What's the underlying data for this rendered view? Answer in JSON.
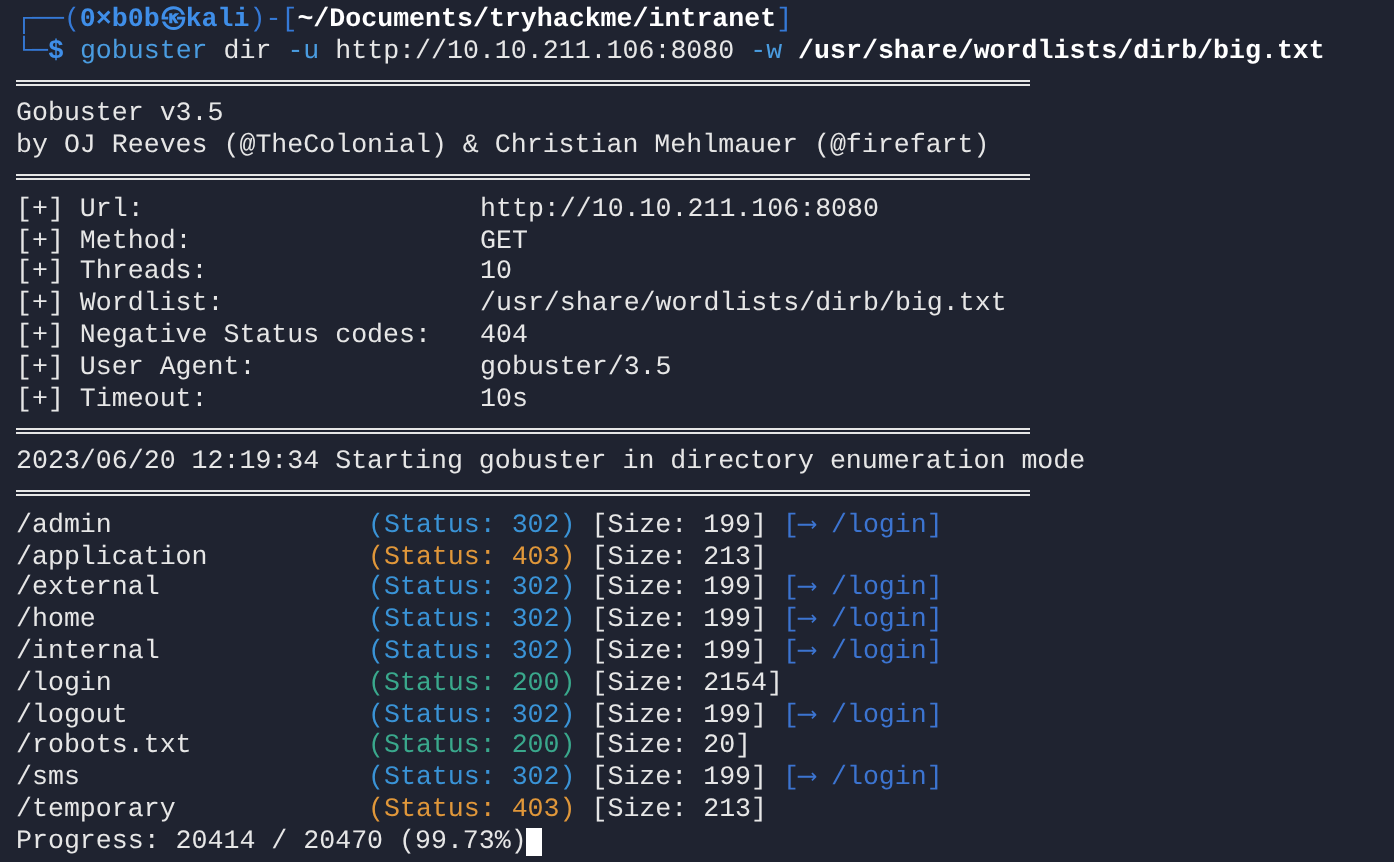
{
  "prompt": [
    {
      "kind": "frame",
      "text": "┌──("
    },
    {
      "kind": "user",
      "text": "0×b0b㉿kali"
    },
    {
      "kind": "frame",
      "text": ")-["
    },
    {
      "kind": "path",
      "text": "~/Documents/tryhackme/intranet"
    },
    {
      "kind": "frame",
      "text": "]"
    }
  ],
  "command": [
    {
      "kind": "frame",
      "text": "└─"
    },
    {
      "kind": "user",
      "text": "$ "
    },
    {
      "kind": "program",
      "text": "gobuster"
    },
    {
      "kind": "arg",
      "text": " dir "
    },
    {
      "kind": "flag",
      "text": "-u"
    },
    {
      "kind": "arg",
      "text": " http://10.10.211.106:8080 "
    },
    {
      "kind": "flag",
      "text": "-w"
    },
    {
      "kind": "path",
      "text": " /usr/share/wordlists/dirb/big.txt"
    }
  ],
  "banner": [
    "Gobuster v3.5",
    "by OJ Reeves (@TheColonial) & Christian Mehlmauer (@firefart)"
  ],
  "settings": [
    {
      "label": "[+] Url:",
      "value": "http://10.10.211.106:8080"
    },
    {
      "label": "[+] Method:",
      "value": "GET"
    },
    {
      "label": "[+] Threads:",
      "value": "10"
    },
    {
      "label": "[+] Wordlist:",
      "value": "/usr/share/wordlists/dirb/big.txt"
    },
    {
      "label": "[+] Negative Status codes:",
      "value": "404"
    },
    {
      "label": "[+] User Agent:",
      "value": "gobuster/3.5"
    },
    {
      "label": "[+] Timeout:",
      "value": "10s"
    }
  ],
  "start_message": "2023/06/20 12:19:34 Starting gobuster in directory enumeration mode",
  "results": [
    {
      "path": "/admin",
      "status": "(Status: 302)",
      "color": "#3a93d6",
      "size": "[Size: 199]",
      "redirect": "[⟶ /login]"
    },
    {
      "path": "/application",
      "status": "(Status: 403)",
      "color": "#e0973a",
      "size": "[Size: 213]"
    },
    {
      "path": "/external",
      "status": "(Status: 302)",
      "color": "#3a93d6",
      "size": "[Size: 199]",
      "redirect": "[⟶ /login]"
    },
    {
      "path": "/home",
      "status": "(Status: 302)",
      "color": "#3a93d6",
      "size": "[Size: 199]",
      "redirect": "[⟶ /login]"
    },
    {
      "path": "/internal",
      "status": "(Status: 302)",
      "color": "#3a93d6",
      "size": "[Size: 199]",
      "redirect": "[⟶ /login]"
    },
    {
      "path": "/login",
      "status": "(Status: 200)",
      "color": "#3aa88c",
      "size": "[Size: 2154]"
    },
    {
      "path": "/logout",
      "status": "(Status: 302)",
      "color": "#3a93d6",
      "size": "[Size: 199]",
      "redirect": "[⟶ /login]"
    },
    {
      "path": "/robots.txt",
      "status": "(Status: 200)",
      "color": "#3aa88c",
      "size": "[Size: 20]"
    },
    {
      "path": "/sms",
      "status": "(Status: 302)",
      "color": "#3a93d6",
      "size": "[Size: 199]",
      "redirect": "[⟶ /login]"
    },
    {
      "path": "/temporary",
      "status": "(Status: 403)",
      "color": "#e0973a",
      "size": "[Size: 213]"
    }
  ],
  "progress": "Progress: 20414 / 20470 (99.73%)"
}
